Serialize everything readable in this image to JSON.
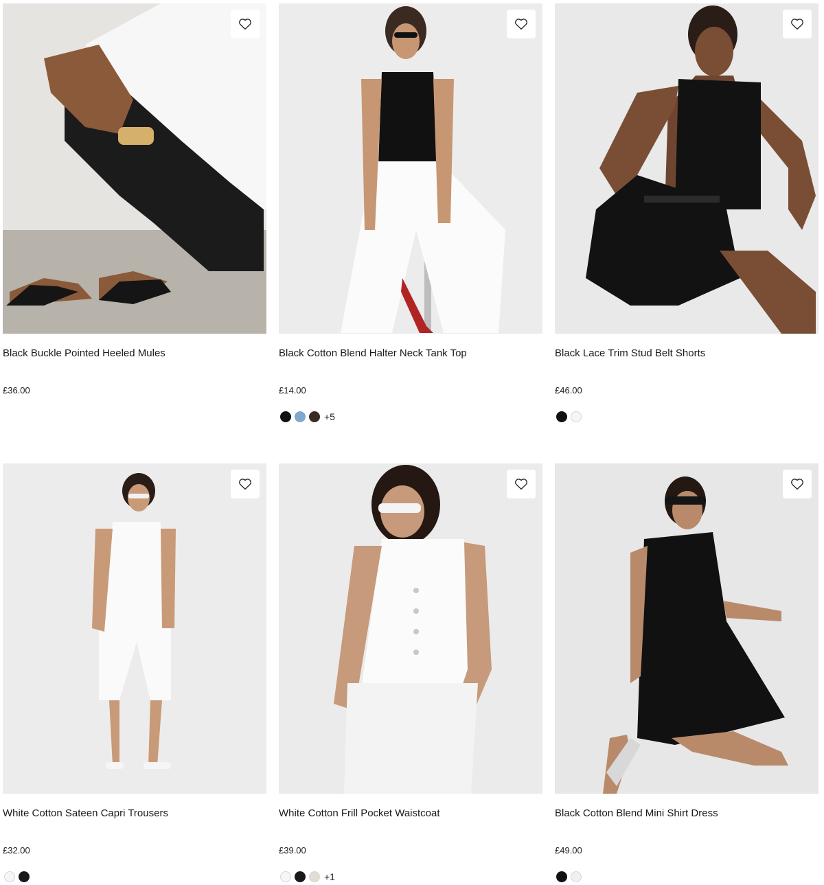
{
  "products": [
    {
      "name": "Black Buckle Pointed Heeled Mules",
      "price": "£36.00",
      "swatches": [],
      "more": "",
      "bg": "#e6e4e0"
    },
    {
      "name": "Black Cotton Blend Halter Neck Tank Top",
      "price": "£14.00",
      "swatches": [
        "#111111",
        "#7fa8cc",
        "#3a2a25"
      ],
      "more": "+5",
      "bg": "#ececec"
    },
    {
      "name": "Black Lace Trim Stud Belt Shorts",
      "price": "£46.00",
      "swatches": [
        "#111111",
        "#f4f6f8"
      ],
      "more": "",
      "bg": "#e9e9e9"
    },
    {
      "name": "White Cotton Sateen Capri Trousers",
      "price": "£32.00",
      "swatches": [
        "#f6f6f6",
        "#1a1a1a"
      ],
      "more": "",
      "bg": "#ececec"
    },
    {
      "name": "White Cotton Frill Pocket Waistcoat",
      "price": "£39.00",
      "swatches": [
        "#f6f6f6",
        "#1a1a1a",
        "#e2ddd3"
      ],
      "more": "+1",
      "bg": "#ebebeb"
    },
    {
      "name": "Black Cotton Blend Mini Shirt Dress",
      "price": "£49.00",
      "swatches": [
        "#111111",
        "#eef1f3"
      ],
      "more": "",
      "bg": "#e7e7e7"
    }
  ]
}
